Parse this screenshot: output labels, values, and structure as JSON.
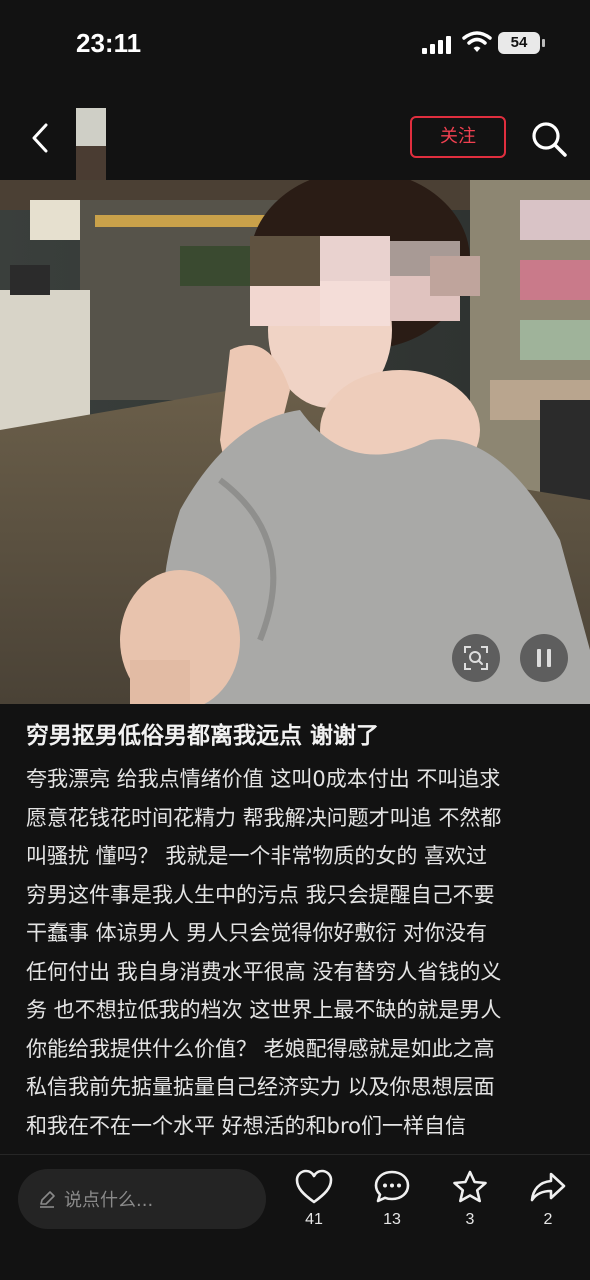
{
  "status_bar": {
    "time": "23:11",
    "battery": "54",
    "icons": [
      "signal-icon",
      "wifi-icon",
      "battery-icon"
    ]
  },
  "nav": {
    "back_icon": "chevron-left-icon",
    "follow_label": "关注",
    "follow_color": "#e02e3e",
    "search_icon": "search-icon"
  },
  "media": {
    "controls": [
      "screenshot-search-icon",
      "pause-icon"
    ]
  },
  "post": {
    "title": "穷男抠男低俗男都离我远点 谢谢了",
    "body_lines": [
      "夸我漂亮 给我点情绪价值 这叫0成本付出 不叫追求",
      "愿意花钱花时间花精力 帮我解决问题才叫追 不然都",
      "叫骚扰 懂吗？ 我就是一个非常物质的女的 喜欢过",
      "穷男这件事是我人生中的污点 我只会提醒自己不要",
      "干蠢事 体谅男人 男人只会觉得你好敷衍 对你没有",
      "任何付出 我自身消费水平很高 没有替穷人省钱的义",
      "务 也不想拉低我的档次 这世界上最不缺的就是男人",
      "你能给我提供什么价值？ 老娘配得感就是如此之高",
      "私信我前先掂量掂量自己经济实力 以及你思想层面",
      "和我在不在一个水平 好想活的和bro们一样自信"
    ]
  },
  "bottom_bar": {
    "comment_placeholder": "说点什么...",
    "like_count": "41",
    "comment_count": "13",
    "favorite_count": "3",
    "share_count": "2"
  }
}
